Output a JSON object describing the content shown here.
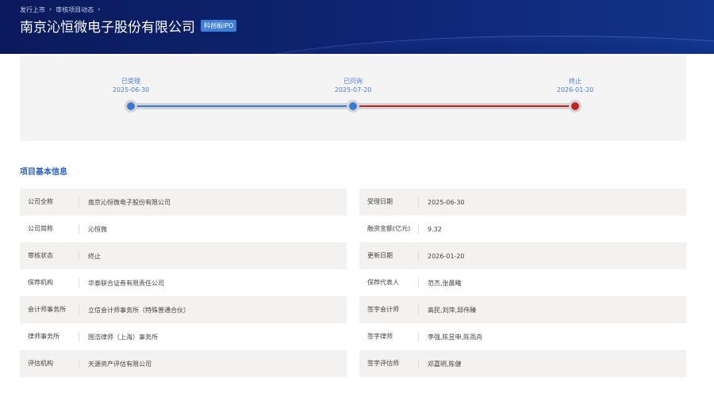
{
  "breadcrumb": [
    "发行上市",
    "审核项目动态"
  ],
  "company": {
    "name": "南京沁恒微电子股份有限公司",
    "board": "科创板IPO"
  },
  "progress": {
    "steps": [
      {
        "label": "已受理",
        "date": "2025-06-30",
        "color": "#3a7ad6"
      },
      {
        "label": "已问询",
        "date": "2025-07-20",
        "color": "#3a7ad6"
      },
      {
        "label": "终止",
        "date": "2026-01-20",
        "color": "#c0221f"
      }
    ]
  },
  "section_title": "项目基本信息",
  "left": [
    {
      "k": "公司全称",
      "v": "南京沁恒微电子股份有限公司"
    },
    {
      "k": "公司简称",
      "v": "沁恒微"
    },
    {
      "k": "审核状态",
      "v": "终止"
    },
    {
      "k": "保荐机构",
      "v": "华泰联合证券有限责任公司"
    },
    {
      "k": "会计师事务所",
      "v": "立信会计师事务所（特殊普通合伙）"
    },
    {
      "k": "律师事务所",
      "v": "国浩律师（上海）事务所"
    },
    {
      "k": "评估机构",
      "v": "天源资产评估有限公司"
    }
  ],
  "right": [
    {
      "k": "受理日期",
      "v": "2025-06-30"
    },
    {
      "k": "融资金额(亿元)",
      "v": "9.32"
    },
    {
      "k": "更新日期",
      "v": "2026-01-20"
    },
    {
      "k": "保荐代表人",
      "v": "范杰,张晨曦"
    },
    {
      "k": "签字会计师",
      "v": "高民,刘萍,邱伟臻"
    },
    {
      "k": "签字律师",
      "v": "李强,陈昱申,陈雨舟"
    },
    {
      "k": "签字评估师",
      "v": "邓嘉明,陈健"
    }
  ]
}
